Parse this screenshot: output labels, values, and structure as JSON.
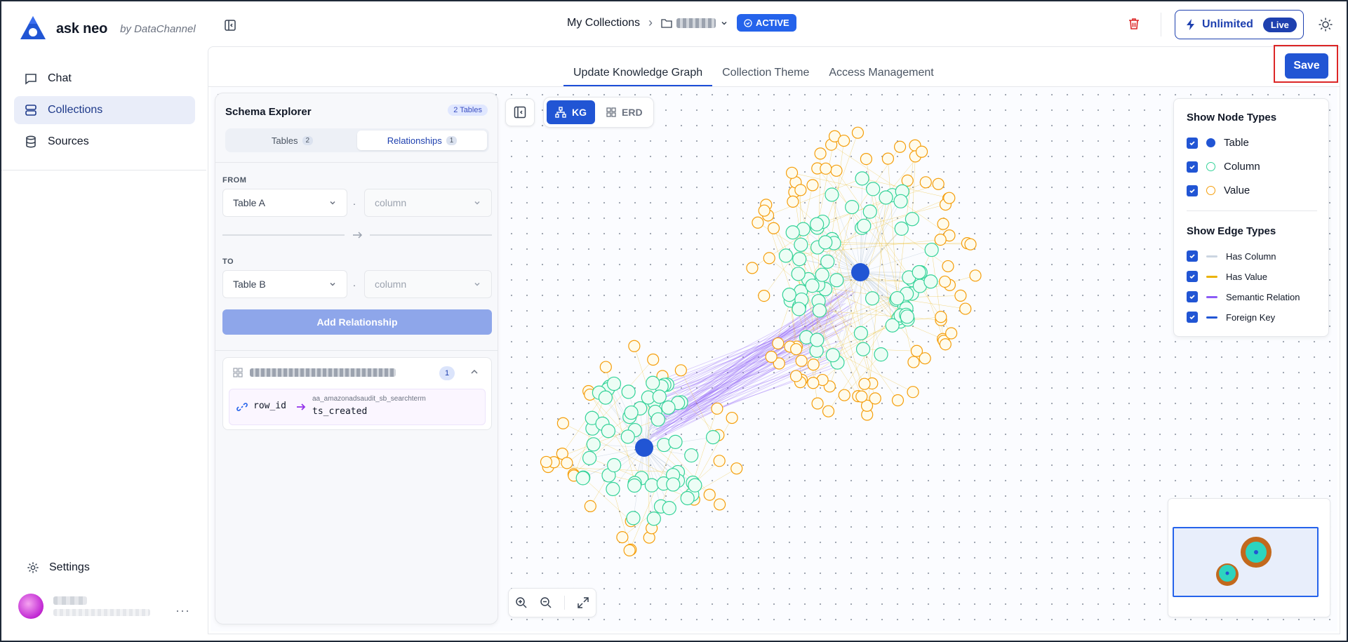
{
  "app": {
    "name": "ask neo",
    "by": "by DataChannel"
  },
  "sidebar": {
    "items": [
      {
        "label": "Chat",
        "icon": "chat-icon",
        "active": false
      },
      {
        "label": "Collections",
        "icon": "collections-icon",
        "active": true
      },
      {
        "label": "Sources",
        "icon": "database-icon",
        "active": false
      }
    ],
    "settings_label": "Settings"
  },
  "header": {
    "breadcrumb_root": "My Collections",
    "status": "ACTIVE",
    "plan_label": "Unlimited",
    "plan_badge": "Live"
  },
  "tabs": [
    {
      "label": "Update Knowledge Graph",
      "active": true
    },
    {
      "label": "Collection Theme",
      "active": false
    },
    {
      "label": "Access Management",
      "active": false
    }
  ],
  "save_label": "Save",
  "schema": {
    "title": "Schema Explorer",
    "count_badge": "2 Tables",
    "seg_tables": "Tables",
    "seg_tables_count": "2",
    "seg_rel": "Relationships",
    "seg_rel_count": "1",
    "from_label": "FROM",
    "to_label": "TO",
    "from_table": "Table A",
    "from_column_placeholder": "column",
    "to_table": "Table B",
    "to_column_placeholder": "column",
    "dot": ".",
    "add_button": "Add Relationship",
    "relationship": {
      "count": "1",
      "from_column": "row_id",
      "target_table": "aa_amazonadsaudit_sb_searchterm",
      "target_column": "ts_created"
    }
  },
  "view_switch": {
    "kg": "KG",
    "erd": "ERD"
  },
  "legend": {
    "node_title": "Show Node Types",
    "nodes": [
      {
        "label": "Table",
        "color": "#2155d4",
        "filled": true
      },
      {
        "label": "Column",
        "color": "#34d399",
        "filled": false
      },
      {
        "label": "Value",
        "color": "#f59e0b",
        "filled": false
      }
    ],
    "edge_title": "Show Edge Types",
    "edges": [
      {
        "label": "Has Column",
        "color": "#cbd5e1"
      },
      {
        "label": "Has Value",
        "color": "#eab308"
      },
      {
        "label": "Semantic Relation",
        "color": "#8b5cf6"
      },
      {
        "label": "Foreign Key",
        "color": "#2155d4"
      }
    ]
  },
  "colors": {
    "accent": "#2155d4",
    "column_node": "#34d399",
    "value_node": "#f59e0b",
    "semantic_edge": "#8b5cf6",
    "danger": "#dc2626"
  }
}
